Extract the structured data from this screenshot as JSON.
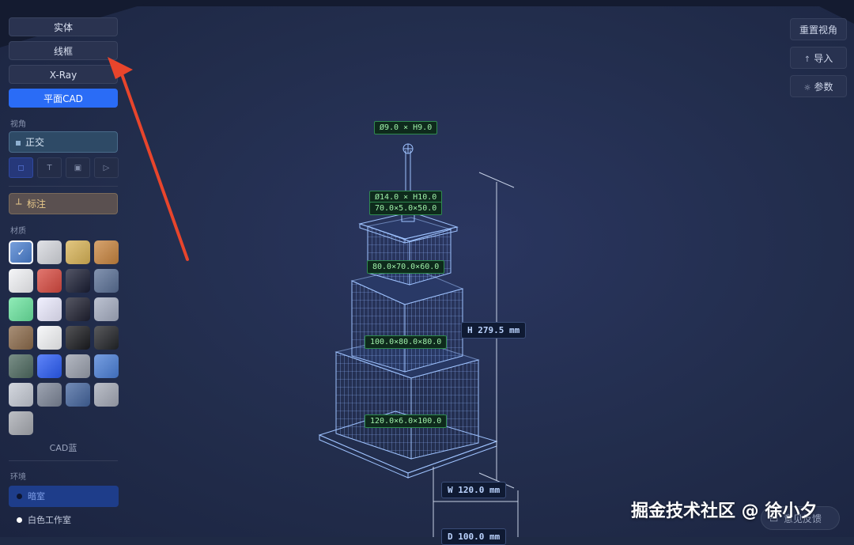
{
  "render_modes": [
    {
      "label": "实体",
      "active": false
    },
    {
      "label": "线框",
      "active": false
    },
    {
      "label": "X-Ray",
      "active": false
    },
    {
      "label": "平面CAD",
      "active": true
    }
  ],
  "view": {
    "section_label": "视角",
    "ortho_label": "正交",
    "view_buttons": [
      "◻",
      "T",
      "▣",
      "▷"
    ]
  },
  "annotation": {
    "label": "标注",
    "icon": "ruler-icon"
  },
  "materials": {
    "section_label": "材质",
    "selected_name": "CAD蓝",
    "swatches": [
      "#4a7fd0",
      "#d6d8de",
      "#d9b457",
      "#c9853f",
      "#f2f3f6",
      "#d84a40",
      "#1a1d33",
      "#5a7096",
      "#6be6a0",
      "#ecebff",
      "#1e2030",
      "#a6aec2",
      "#8b6a4a",
      "#f5f6f8",
      "#1a1b1f",
      "#222428",
      "#4e6a60",
      "#2a5cf6",
      "#9aa0ad",
      "#4a7fd8",
      "#c5cad4",
      "#7d8698",
      "#44659e",
      "#a5aab7",
      "#a8abb2"
    ]
  },
  "environment": {
    "section_label": "环境",
    "options": [
      {
        "label": "暗室",
        "selected": true
      },
      {
        "label": "白色工作室",
        "selected": false
      }
    ]
  },
  "toolbar": {
    "reset_view": "重置视角",
    "import": "导入",
    "import_icon": "↑",
    "params": "参数",
    "params_icon": "☼"
  },
  "model_labels": {
    "top_cylinder": "Ø9.0 × H9.0",
    "mid_cylinder": "Ø14.0 × H10.0",
    "cap_box": "70.0×5.0×50.0",
    "tier3": "80.0×70.0×60.0",
    "tier2": "100.0×80.0×80.0",
    "base": "120.0×6.0×100.0"
  },
  "dimensions": {
    "height": "H 279.5 mm",
    "width": "W 120.0 mm",
    "depth": "D 100.0 mm"
  },
  "watermark": "掘金技术社区 @ 徐小夕",
  "feedback": {
    "label": "意见反馈",
    "icon": "chat-icon"
  },
  "colors": {
    "accent": "#2a6cf6",
    "tag_green": "#9ff0a9",
    "wire_blue": "#9fc3ff"
  }
}
